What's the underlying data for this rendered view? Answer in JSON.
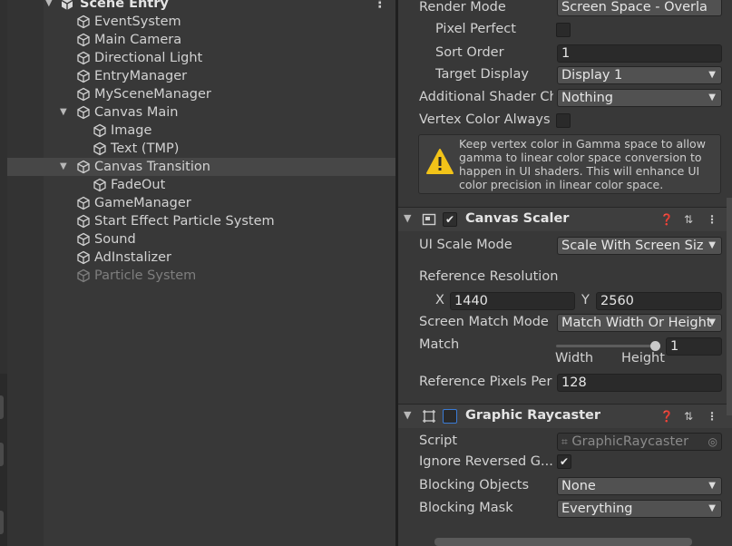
{
  "hierarchy": {
    "scene_title": "Scene Entry",
    "items": [
      {
        "label": "EventSystem"
      },
      {
        "label": "Main Camera"
      },
      {
        "label": "Directional Light"
      },
      {
        "label": "EntryManager"
      },
      {
        "label": "MySceneManager"
      },
      {
        "label": "Canvas Main"
      },
      {
        "label": "Image"
      },
      {
        "label": "Text (TMP)"
      },
      {
        "label": "Canvas Transition"
      },
      {
        "label": "FadeOut"
      },
      {
        "label": "GameManager"
      },
      {
        "label": "Start Effect Particle System"
      },
      {
        "label": "Sound"
      },
      {
        "label": "AdInstalizer"
      },
      {
        "label": "Particle System"
      }
    ]
  },
  "canvas": {
    "render_mode_label": "Render Mode",
    "render_mode_value": "Screen Space - Overla",
    "pixel_perfect_label": "Pixel Perfect",
    "sort_order_label": "Sort Order",
    "sort_order_value": "1",
    "target_display_label": "Target Display",
    "target_display_value": "Display 1",
    "shader_ch_label": "Additional Shader Ch",
    "shader_ch_value": "Nothing",
    "vertex_color_label": "Vertex Color Always",
    "help_text": "Keep vertex color in Gamma space to allow gamma to linear color space conversion to happen in UI shaders. This will enhance UI color precision in linear color space."
  },
  "canvas_scaler": {
    "title": "Canvas Scaler",
    "ui_scale_mode_label": "UI Scale Mode",
    "ui_scale_mode_value": "Scale With Screen Siz",
    "ref_resolution_label": "Reference Resolution",
    "x_label": "X",
    "x_value": "1440",
    "y_label": "Y",
    "y_value": "2560",
    "screen_match_label": "Screen Match Mode",
    "screen_match_value": "Match Width Or Height",
    "match_label": "Match",
    "match_value": "1",
    "width_label": "Width",
    "height_label": "Height",
    "ref_pixels_label": "Reference Pixels Per",
    "ref_pixels_value": "128"
  },
  "graphic_raycaster": {
    "title": "Graphic Raycaster",
    "script_label": "Script",
    "script_value": "GraphicRaycaster",
    "ignore_reversed_label": "Ignore Reversed G...",
    "blocking_objects_label": "Blocking Objects",
    "blocking_objects_value": "None",
    "blocking_mask_label": "Blocking Mask",
    "blocking_mask_value": "Everything"
  },
  "colors": {
    "panel": "#383838",
    "field": "#2a2a2a",
    "dropdown": "#515151",
    "warning": "#f2c318"
  }
}
